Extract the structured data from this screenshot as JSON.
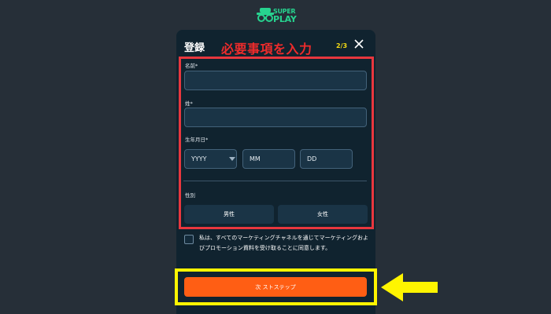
{
  "brand": {
    "logo_line1": "SUPER",
    "logo_line2": "PLAY"
  },
  "modal": {
    "title": "登録",
    "annotation": "必要事項を入力",
    "step": "2/3"
  },
  "form": {
    "first_name_label": "名前*",
    "first_name_value": "",
    "last_name_label": "姓*",
    "last_name_value": "",
    "birthdate_label": "生年月日*",
    "year_placeholder": "YYYY",
    "month_placeholder": "MM",
    "day_placeholder": "DD",
    "gender_label": "性別",
    "gender_male": "男性",
    "gender_female": "女性",
    "consent_text": "私は、すべてのマーケティングチャネルを通じてマーケティングおよびプロモーション資料を受け取ることに同意します。",
    "consent_checked": false
  },
  "next_button": "次 ストステップ",
  "colors": {
    "background": "#262f38",
    "modal": "#10232f",
    "annotation_red": "#e8373e",
    "annotation_yellow": "#fff500",
    "primary": "#ff5e14",
    "brand_green": "#27d38f"
  },
  "icons": {
    "close": "close-icon",
    "caret": "caret-down-icon",
    "logo": "glasses-logo-icon",
    "arrow": "arrow-left-icon"
  }
}
